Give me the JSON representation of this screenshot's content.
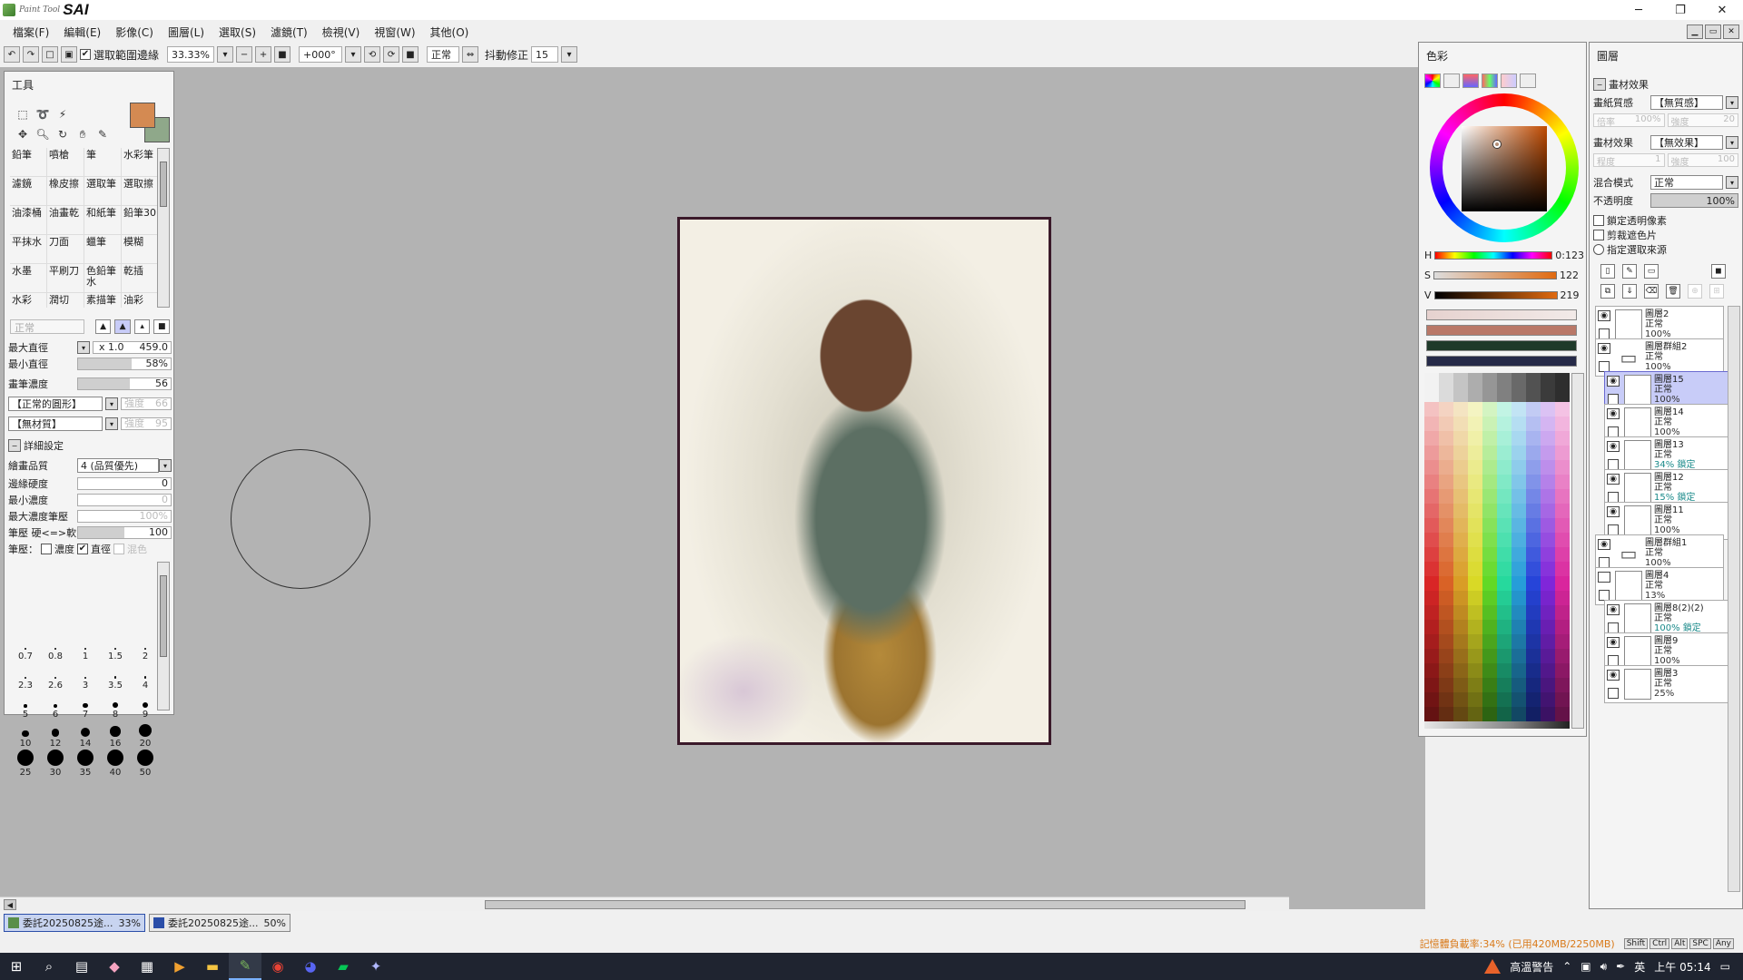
{
  "app": {
    "logo_small": "Paint Tool",
    "logo_big": "SAI",
    "win_minimize": "─",
    "win_restore": "❐",
    "win_close": "✕"
  },
  "menu": [
    "檔案(F)",
    "編輯(E)",
    "影像(C)",
    "圖層(L)",
    "選取(S)",
    "濾鏡(T)",
    "檢視(V)",
    "視窗(W)",
    "其他(O)"
  ],
  "toolbar": {
    "select_edge_label": "選取範圍邊緣",
    "zoom": "33.33%",
    "rotation": "+000°",
    "blend": "正常",
    "stabilizer_label": "抖動修正",
    "stabilizer_value": "15"
  },
  "tools_panel": {
    "title": "工具",
    "brushes": [
      "鉛筆",
      "噴槍",
      "筆",
      "水彩筆",
      "濾鏡",
      "橡皮擦",
      "選取筆",
      "選取擦",
      "油漆桶",
      "油畫乾",
      "和紙筆",
      "鉛筆30",
      "平抹水",
      "刀面",
      "蠟筆",
      "模糊",
      "水墨",
      "平刷刀",
      "色鉛筆水",
      "乾插",
      "水彩",
      "潤切",
      "素描筆",
      "油彩"
    ],
    "mode_placeholder": "正常",
    "max_size_label": "最大直徑",
    "max_size_mult": "x 1.0",
    "max_size_value": "459.0",
    "min_size_label": "最小直徑",
    "min_size_value": "58%",
    "min_size_fill": 0.58,
    "density_label": "畫筆濃度",
    "density_value": "56",
    "density_fill": 0.56,
    "shape_select": "【正常的圓形】",
    "shape_strength_label": "強度",
    "shape_strength": "66",
    "texture_select": "【無材質】",
    "texture_strength_label": "強度",
    "texture_strength": "95",
    "detail_label": "詳細設定",
    "quality_label": "繪畫品質",
    "quality_value": "4 (品質優先)",
    "edge_label": "邊緣硬度",
    "edge_value": "0",
    "min_density_label": "最小濃度",
    "min_density_value": "0",
    "max_density_label": "最大濃度筆壓",
    "max_density_value": "100%",
    "pressure_label": "筆壓 硬<=>軟",
    "pressure_value": "100",
    "pressure_opts_label": "筆壓：",
    "pressure_opt1": "濃度",
    "pressure_opt2": "直徑",
    "pressure_opt3": "混色",
    "brush_sizes": [
      "0.7",
      "0.8",
      "1",
      "1.5",
      "2",
      "2.3",
      "2.6",
      "3",
      "3.5",
      "4",
      "5",
      "6",
      "7",
      "8",
      "9",
      "10",
      "12",
      "14",
      "16",
      "20",
      "25",
      "30",
      "35",
      "40",
      "50"
    ],
    "fg_color": "#d48a52",
    "bg_color": "#8fa88a"
  },
  "color_panel": {
    "title": "色彩",
    "h_label": "H",
    "h_value": "0:123",
    "s_label": "S",
    "s_value": "122",
    "v_label": "V",
    "v_value": "219"
  },
  "layers_panel": {
    "title": "圖層",
    "effects_label": "畫材效果",
    "paper_label": "畫紙質感",
    "paper_value": "【無質感】",
    "paper_scale_label": "倍率",
    "paper_scale": "100%",
    "paper_strength_label": "強度",
    "paper_strength": "20",
    "material_label": "畫材效果",
    "material_value": "【無效果】",
    "degree_label": "程度",
    "degree_value": "1",
    "material_strength_label": "強度",
    "material_strength": "100",
    "blend_label": "混合模式",
    "blend_value": "正常",
    "opacity_label": "不透明度",
    "opacity_value": "100%",
    "lock_alpha": "鎖定透明像素",
    "clip": "剪裁遮色片",
    "selection_source": "指定選取來源",
    "layers": [
      {
        "name": "圖層2",
        "mode": "正常",
        "opacity": "100%",
        "folder": false,
        "visible": true
      },
      {
        "name": "圖層群組2",
        "mode": "正常",
        "opacity": "100%",
        "folder": true,
        "visible": true
      },
      {
        "name": "圖層15",
        "mode": "正常",
        "opacity": "100%",
        "folder": false,
        "visible": true,
        "active": true
      },
      {
        "name": "圖層14",
        "mode": "正常",
        "opacity": "100%",
        "folder": false,
        "visible": true
      },
      {
        "name": "圖層13",
        "mode": "正常",
        "opacity": "34%",
        "lock": "鎖定",
        "folder": false,
        "visible": true
      },
      {
        "name": "圖層12",
        "mode": "正常",
        "opacity": "15%",
        "lock": "鎖定",
        "folder": false,
        "visible": true
      },
      {
        "name": "圖層11",
        "mode": "正常",
        "opacity": "100%",
        "folder": false,
        "visible": true
      },
      {
        "name": "圖層群組1",
        "mode": "正常",
        "opacity": "100%",
        "folder": true,
        "visible": true
      },
      {
        "name": "圖層4",
        "mode": "正常",
        "opacity": "13%",
        "folder": false,
        "visible": false
      },
      {
        "name": "圖層8(2)(2)",
        "mode": "正常",
        "opacity": "100%",
        "lock": "鎖定",
        "folder": false,
        "visible": true
      },
      {
        "name": "圖層9",
        "mode": "正常",
        "opacity": "100%",
        "folder": false,
        "visible": true
      },
      {
        "name": "圖層3",
        "mode": "正常",
        "opacity": "25%",
        "folder": false,
        "visible": true
      }
    ]
  },
  "doc_tabs": [
    {
      "name": "委託20250825途...",
      "zoom": "33%",
      "active": true
    },
    {
      "name": "委託20250825途...",
      "zoom": "50%",
      "active": false
    }
  ],
  "status": {
    "memory": "記憶體負載率:34% (已用420MB/2250MB)",
    "keys": [
      "Shift",
      "Ctrl",
      "Alt",
      "SPC",
      "Any"
    ]
  },
  "taskbar": {
    "warning": "高溫警告",
    "ime": "英",
    "time": "上午 05:14"
  }
}
